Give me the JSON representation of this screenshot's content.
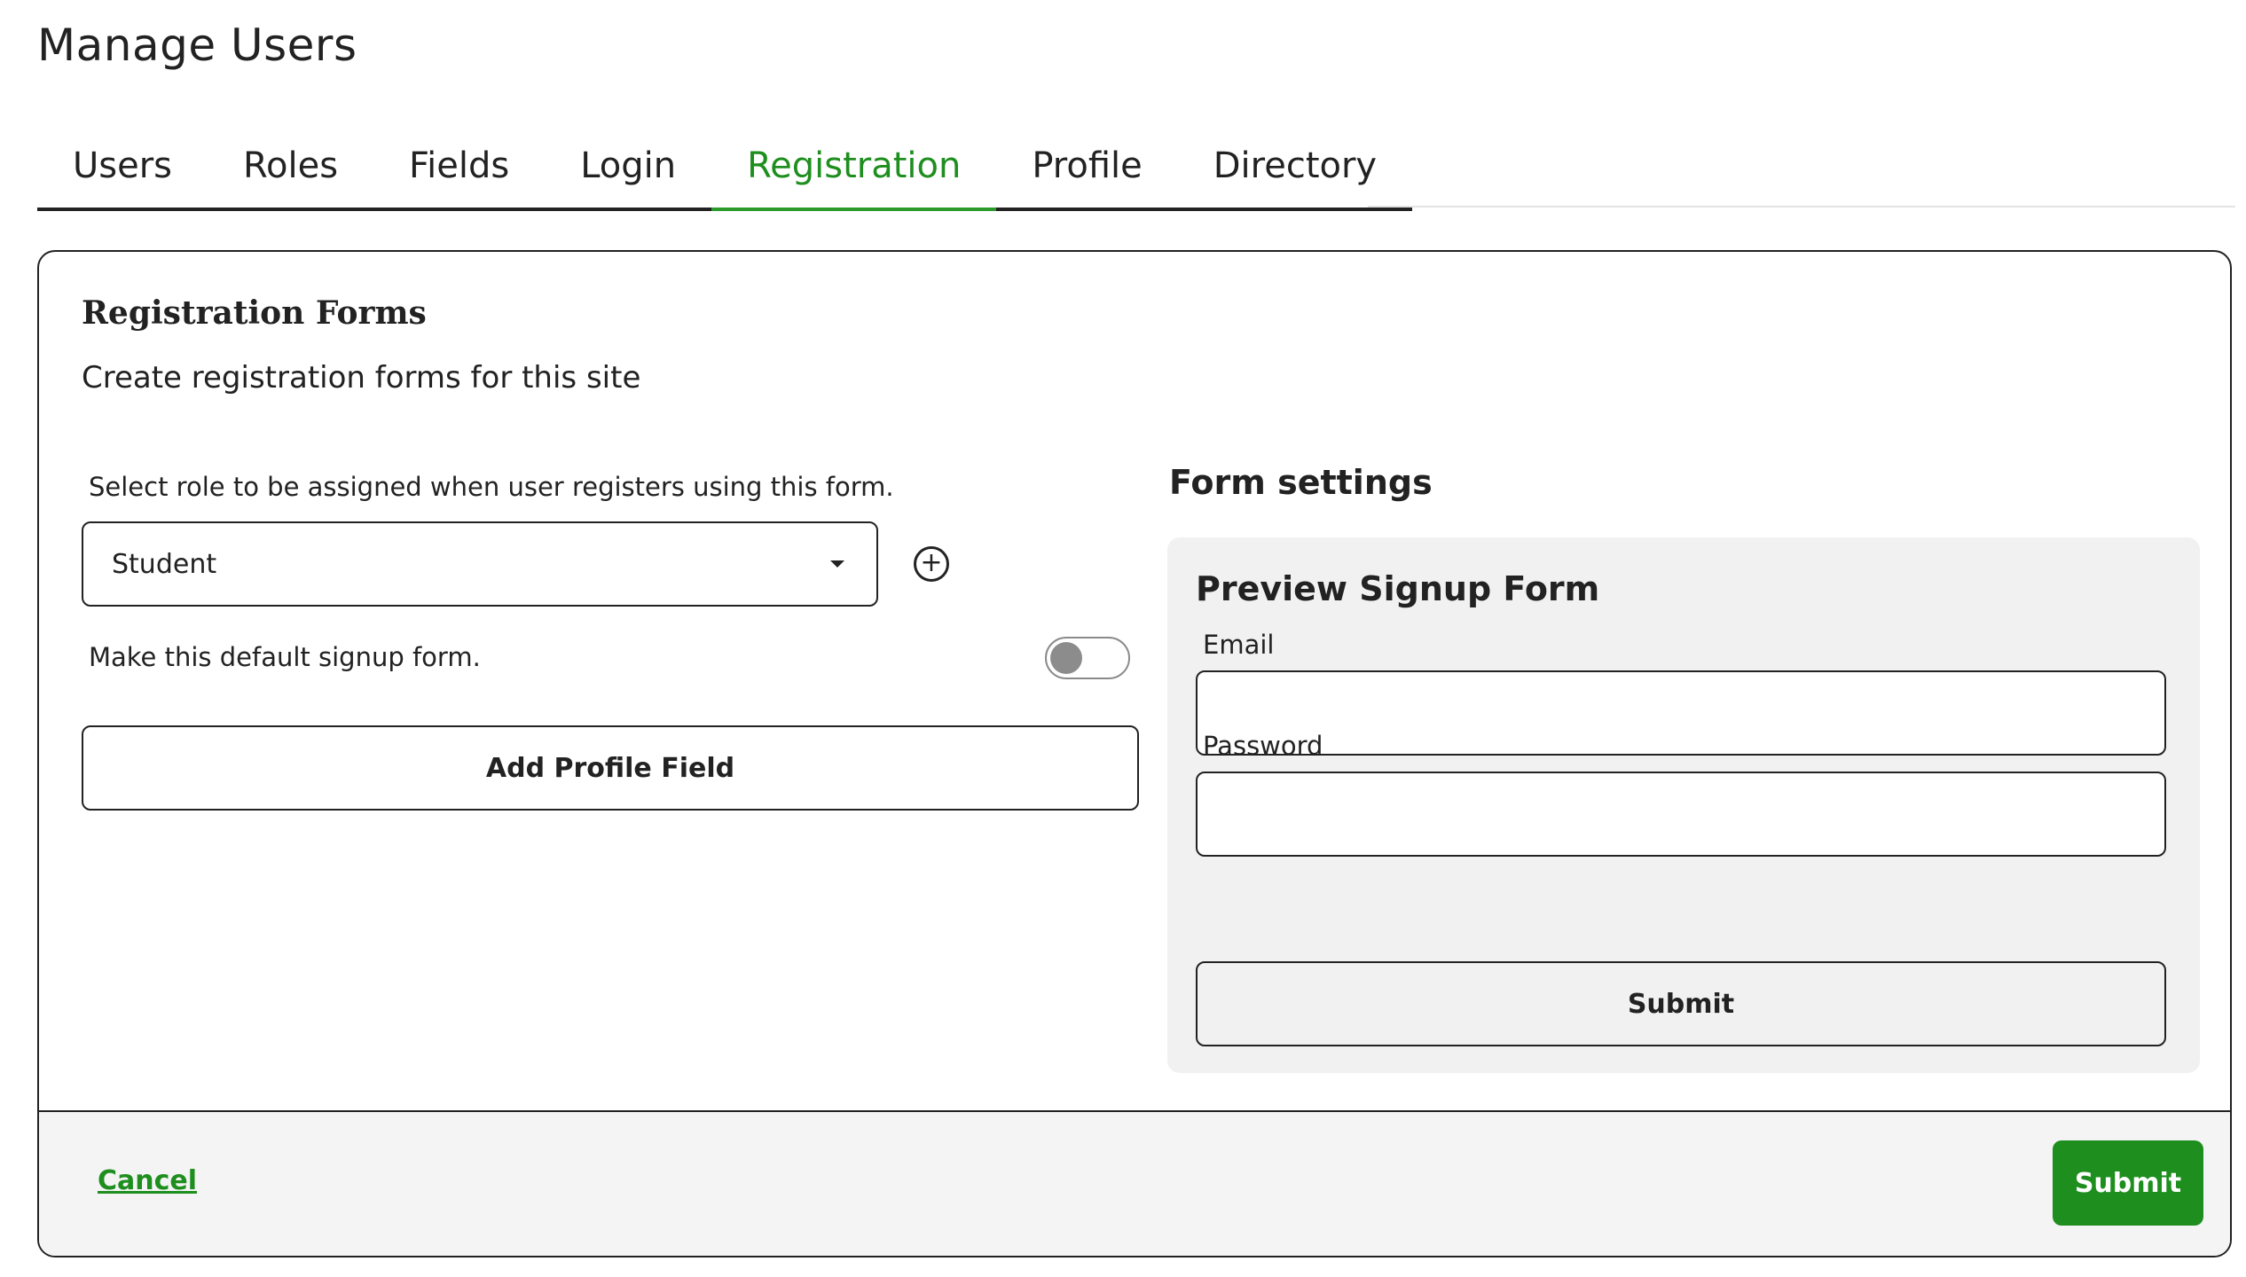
{
  "page": {
    "title": "Manage Users"
  },
  "tabs": [
    {
      "label": "Users"
    },
    {
      "label": "Roles"
    },
    {
      "label": "Fields"
    },
    {
      "label": "Login"
    },
    {
      "label": "Registration",
      "active": true
    },
    {
      "label": "Profile"
    },
    {
      "label": "Directory"
    }
  ],
  "card": {
    "title": "Registration Forms",
    "subtitle": "Create registration forms for this site",
    "role_label": "Select role to be assigned when user registers using this form.",
    "role_value": "Student",
    "default_label": "Make this default signup form.",
    "default_toggle": false,
    "add_profile_field": "Add Profile Field"
  },
  "form_settings": {
    "heading": "Form settings",
    "preview_title": "Preview Signup Form",
    "email_label": "Email",
    "password_label": "Password",
    "submit_label": "Submit"
  },
  "footer": {
    "cancel_label": "Cancel",
    "submit_label": "Submit"
  },
  "colors": {
    "accent": "#1e8e1e",
    "border": "#222222",
    "preview_bg": "#f1f1f1"
  },
  "icons": {
    "add_role": "plus-circle-icon",
    "select_caret": "chevron-down-icon"
  }
}
